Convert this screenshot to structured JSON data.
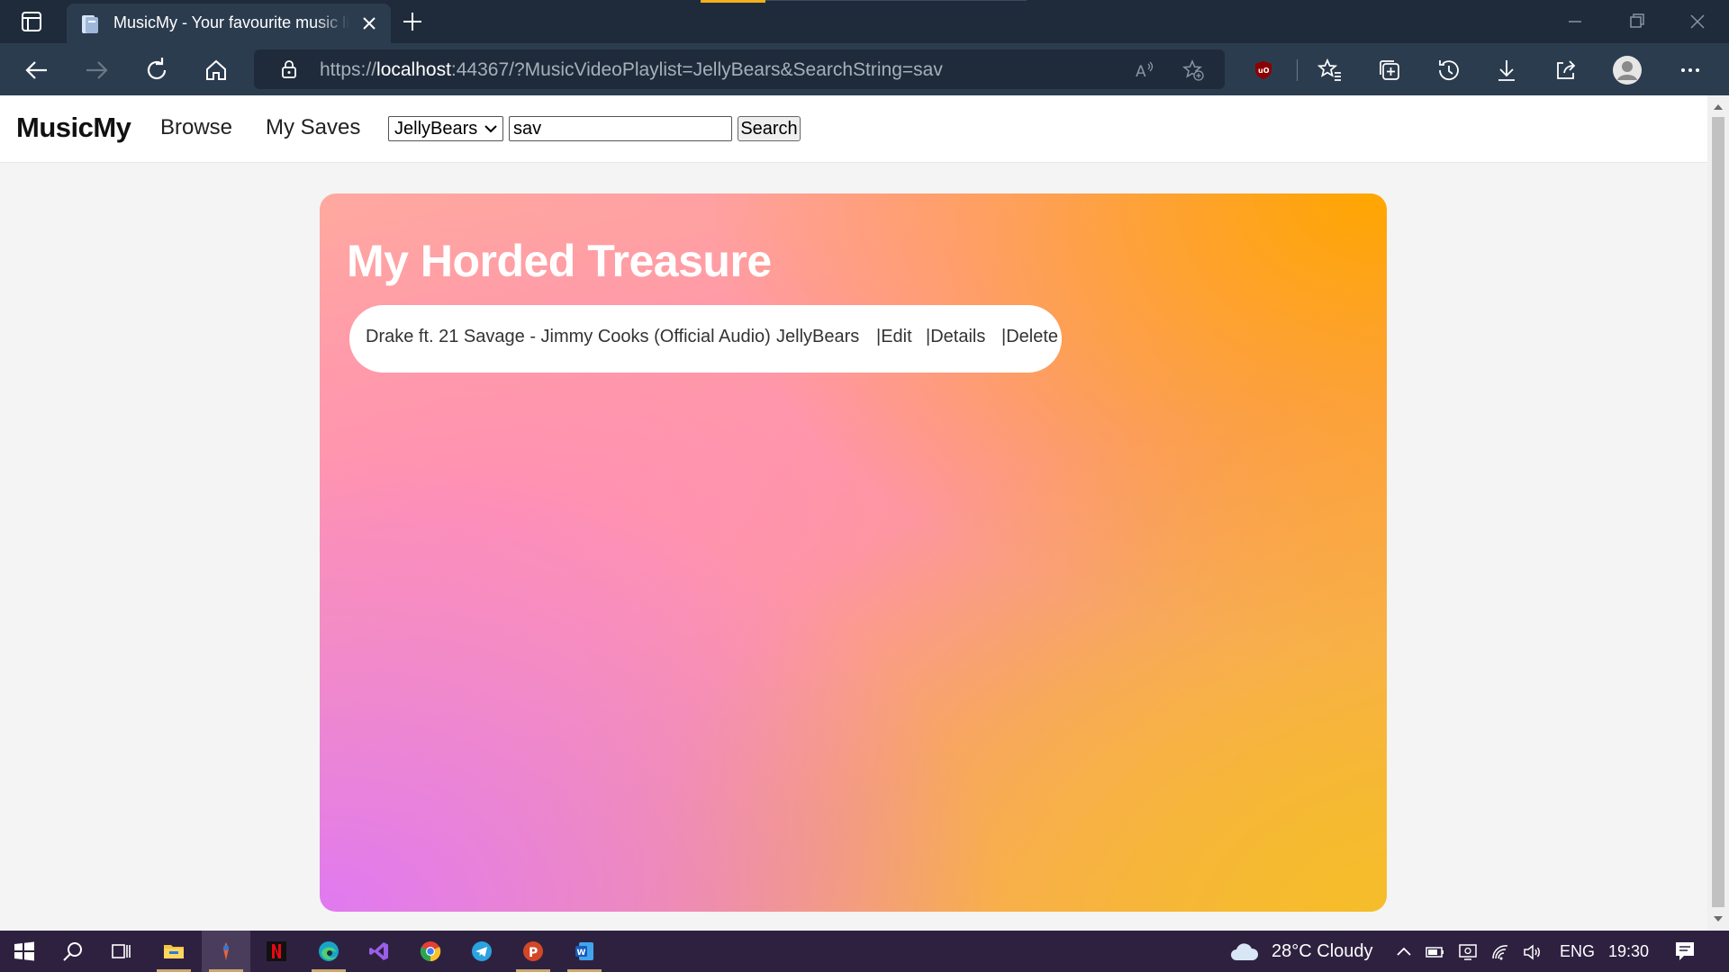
{
  "browser": {
    "tab_title": "MusicMy - Your favourite music library",
    "url_scheme": "https://",
    "url_host": "localhost",
    "url_rest": ":44367/?MusicVideoPlaylist=JellyBears&SearchString=sav"
  },
  "site": {
    "brand": "MusicMy",
    "nav": {
      "browse": "Browse",
      "my_saves": "My Saves"
    },
    "filter": {
      "playlist_selected": "JellyBears",
      "search_value": "sav",
      "search_button": "Search"
    }
  },
  "main": {
    "heading": "My Horded Treasure",
    "results": [
      {
        "title": "Drake ft. 21 Savage - Jimmy Cooks (Official Audio)",
        "playlist": "JellyBears",
        "edit": "|Edit",
        "details": "|Details",
        "delete": "|Delete"
      }
    ]
  },
  "taskbar": {
    "weather": "28°C  Cloudy",
    "language": "ENG",
    "time": "19:30",
    "apps": [
      "windows-start",
      "search",
      "task-view",
      "file-explorer",
      "app-pinned",
      "netflix",
      "edge",
      "visual-studio",
      "chrome",
      "telegram",
      "powerpoint",
      "word"
    ]
  },
  "colors": {
    "tab_bg": "#2c3c4f",
    "chrome_dark": "#1f2b3a",
    "card_orange": "#ffa600",
    "card_pink": "#ff90b4",
    "card_violet": "#e079f0",
    "taskbar": "#2e2140"
  }
}
